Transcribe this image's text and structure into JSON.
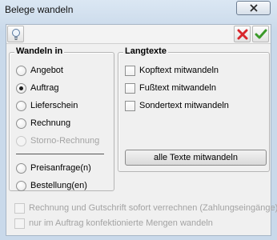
{
  "window": {
    "title": "Belege wandeln"
  },
  "toolbar": {
    "info_icon": "lightbulb-icon",
    "cancel_icon": "red-x-icon",
    "ok_icon": "green-check-icon"
  },
  "wandeln_group": {
    "title": "Wandeln in",
    "options": [
      {
        "label": "Angebot",
        "selected": false,
        "enabled": true
      },
      {
        "label": "Auftrag",
        "selected": true,
        "enabled": true
      },
      {
        "label": "Lieferschein",
        "selected": false,
        "enabled": true
      },
      {
        "label": "Rechnung",
        "selected": false,
        "enabled": true
      },
      {
        "label": "Storno-Rechnung",
        "selected": false,
        "enabled": false
      },
      {
        "label": "Preisanfrage(n)",
        "selected": false,
        "enabled": true
      },
      {
        "label": "Bestellung(en)",
        "selected": false,
        "enabled": true
      }
    ]
  },
  "langtexte_group": {
    "title": "Langtexte",
    "checkboxes": [
      {
        "label": "Kopftext mitwandeln",
        "checked": false
      },
      {
        "label": "Fußtext mitwandeln",
        "checked": false
      },
      {
        "label": "Sondertext mitwandeln",
        "checked": false
      }
    ],
    "all_button": "alle Texte mitwandeln"
  },
  "bottom_options": [
    {
      "label": "Rechnung und Gutschrift sofort verrechnen (Zahlungseingänge)",
      "checked": false,
      "enabled": false
    },
    {
      "label": "nur im Auftrag konfektionierte Mengen wandeln",
      "checked": false,
      "enabled": false
    }
  ],
  "colors": {
    "cancel_red": "#d8262b",
    "ok_green": "#3b9a2a",
    "accent": "#c9d9ea"
  }
}
